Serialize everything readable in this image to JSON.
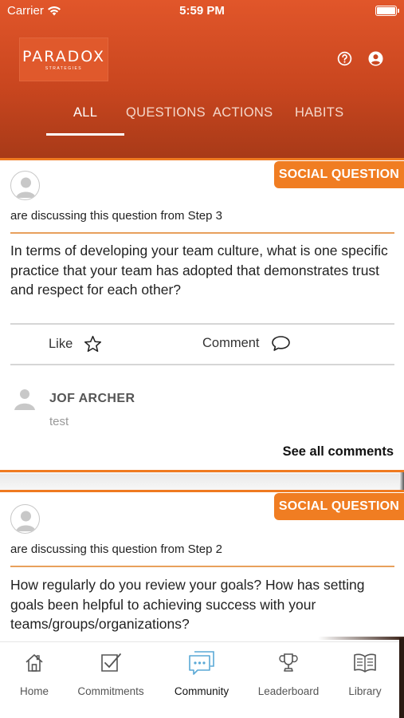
{
  "status_bar": {
    "carrier": "Carrier",
    "time": "5:59 PM"
  },
  "header": {
    "logo_text": "PARADOX",
    "logo_subtext": "STRATEGIES",
    "icons": [
      "help-icon",
      "account-icon"
    ],
    "tabs": [
      {
        "label": "ALL",
        "active": true
      },
      {
        "label": "QUESTIONS",
        "active": false
      },
      {
        "label": "ACTIONS",
        "active": false
      },
      {
        "label": "HABITS",
        "active": false
      }
    ]
  },
  "posts": [
    {
      "tag": "SOCIAL QUESTION",
      "discussing": "are discussing this question from Step 3",
      "question": "In terms of developing your team culture, what is one specific practice that your team has adopted that demonstrates trust and respect for each other?",
      "like_label": "Like",
      "comment_label": "Comment",
      "latest_comment": {
        "author": "JOF ARCHER",
        "text": "test"
      },
      "see_all_label": "See all comments"
    },
    {
      "tag": "SOCIAL QUESTION",
      "discussing": "are discussing this question from Step 2",
      "question": "How regularly do you review your goals? How has setting goals been helpful to achieving success with your teams/groups/organizations?"
    }
  ],
  "bottom_nav": [
    {
      "label": "Home",
      "icon": "home-icon"
    },
    {
      "label": "Commitments",
      "icon": "checklist-icon"
    },
    {
      "label": "Community",
      "icon": "chat-bubbles-icon",
      "active": true
    },
    {
      "label": "Leaderboard",
      "icon": "trophy-icon"
    },
    {
      "label": "Library",
      "icon": "book-icon"
    }
  ],
  "colors": {
    "header_orange": "#d4501f",
    "accent_orange": "#f07d22",
    "community_blue": "#5aa9d6"
  }
}
